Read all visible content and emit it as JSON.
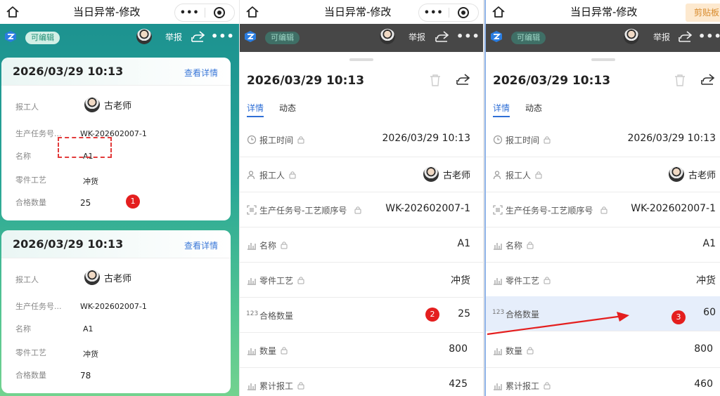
{
  "screen_title": "当日异常-修改",
  "capsule": {
    "more": "•••"
  },
  "clipboard_label": "剪贴板",
  "toolbar": {
    "editable": "可编辑",
    "report": "举报",
    "more": "•••"
  },
  "list_cards": [
    {
      "datetime": "2026/03/29 10:13",
      "detail_link": "查看详情",
      "fields": [
        {
          "label": "报工人",
          "value": "古老师"
        },
        {
          "label": "生产任务号...",
          "value": "WK-202602007-1"
        },
        {
          "label": "名称",
          "value": "A1"
        },
        {
          "label": "零件工艺",
          "value": "冲货"
        },
        {
          "label": "合格数量",
          "value": "25"
        }
      ]
    },
    {
      "datetime": "2026/03/29 10:13",
      "detail_link": "查看详情",
      "fields": [
        {
          "label": "报工人",
          "value": "古老师"
        },
        {
          "label": "生产任务号...",
          "value": "WK-202602007-1"
        },
        {
          "label": "名称",
          "value": "A1"
        },
        {
          "label": "零件工艺",
          "value": "冲货"
        },
        {
          "label": "合格数量",
          "value": "78"
        }
      ]
    }
  ],
  "detail_tabs": [
    "详情",
    "动态"
  ],
  "detail_before": {
    "datetime": "2026/03/29 10:13",
    "fields": [
      {
        "label": "报工时间",
        "value": "2026/03/29 10:13"
      },
      {
        "label": "报工人",
        "value": "古老师"
      },
      {
        "label": "生产任务号-工艺顺序号",
        "value": "WK-202602007-1"
      },
      {
        "label": "名称",
        "value": "A1"
      },
      {
        "label": "零件工艺",
        "value": "冲货"
      },
      {
        "label": "合格数量",
        "value": "25",
        "type_tag": "123"
      },
      {
        "label": "数量",
        "value": "800"
      },
      {
        "label": "累计报工",
        "value": "425"
      }
    ]
  },
  "detail_after": {
    "datetime": "2026/03/29 10:13",
    "fields": [
      {
        "label": "报工时间",
        "value": "2026/03/29 10:13"
      },
      {
        "label": "报工人",
        "value": "古老师"
      },
      {
        "label": "生产任务号-工艺顺序号",
        "value": "WK-202602007-1"
      },
      {
        "label": "名称",
        "value": "A1"
      },
      {
        "label": "零件工艺",
        "value": "冲货"
      },
      {
        "label": "合格数量",
        "value": "60",
        "type_tag": "123"
      },
      {
        "label": "数量",
        "value": "800"
      },
      {
        "label": "累计报工",
        "value": "460"
      }
    ]
  },
  "annotations": [
    "1",
    "2",
    "3"
  ],
  "colors": {
    "accent": "#2f6fd6",
    "marker": "#e41e1e",
    "highlight_row": "#e6eefb"
  }
}
